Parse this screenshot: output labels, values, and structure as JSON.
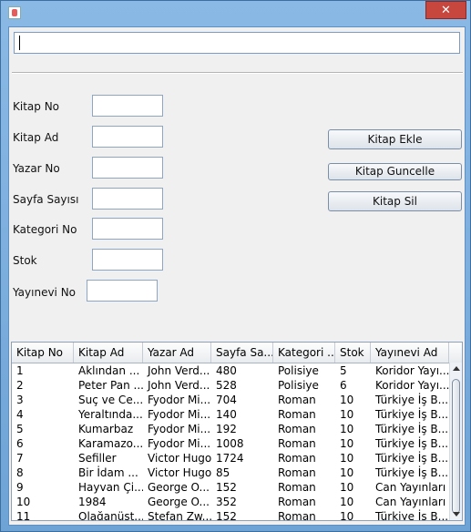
{
  "window": {
    "close_glyph": "✕",
    "icon": "java-app-icon"
  },
  "search": {
    "value": ""
  },
  "form": {
    "fields": [
      {
        "label": "Kitap No",
        "value": ""
      },
      {
        "label": "Kitap Ad",
        "value": ""
      },
      {
        "label": "Yazar No",
        "value": ""
      },
      {
        "label": "Sayfa Sayısı",
        "value": ""
      },
      {
        "label": "Kategori No",
        "value": ""
      },
      {
        "label": "Stok",
        "value": ""
      },
      {
        "label": "Yayınevi No",
        "value": ""
      }
    ]
  },
  "buttons": {
    "add": "Kitap Ekle",
    "update": "Kitap Guncelle",
    "delete": "Kitap Sil"
  },
  "table": {
    "columns": [
      "Kitap No",
      "Kitap Ad",
      "Yazar Ad",
      "Sayfa Sa...",
      "Kategori ...",
      "Stok",
      "Yayınevi Ad"
    ],
    "rows": [
      [
        "1",
        "Aklından ...",
        "John Verd...",
        "480",
        "Polisiye",
        "5",
        "Koridor Yayı..."
      ],
      [
        "2",
        "Peter Pan ...",
        "John Verd...",
        "528",
        "Polisiye",
        "6",
        "Koridor Yayı..."
      ],
      [
        "3",
        "Suç ve Ce...",
        "Fyodor Mi...",
        "704",
        "Roman",
        "10",
        "Türkiye İş B..."
      ],
      [
        "4",
        "Yeraltında...",
        "Fyodor Mi...",
        "140",
        "Roman",
        "10",
        "Türkiye İş B..."
      ],
      [
        "5",
        "Kumarbaz",
        "Fyodor Mi...",
        "192",
        "Roman",
        "10",
        "Türkiye İş B..."
      ],
      [
        "6",
        "Karamazo...",
        "Fyodor Mi...",
        "1008",
        "Roman",
        "10",
        "Türkiye İş B..."
      ],
      [
        "7",
        "Sefiller",
        "Victor Hugo",
        "1724",
        "Roman",
        "10",
        "Türkiye İş B..."
      ],
      [
        "8",
        "Bir İdam ...",
        "Victor Hugo",
        "85",
        "Roman",
        "10",
        "Türkiye İş B..."
      ],
      [
        "9",
        "Hayvan Çi...",
        "George O...",
        "152",
        "Roman",
        "10",
        "Can Yayınları"
      ],
      [
        "10",
        "1984",
        "George O...",
        "352",
        "Roman",
        "10",
        "Can Yayınları"
      ],
      [
        "11",
        "Olağanüst...",
        "Stefan Zw...",
        "152",
        "Roman",
        "10",
        "Türkiye İş B..."
      ]
    ]
  }
}
